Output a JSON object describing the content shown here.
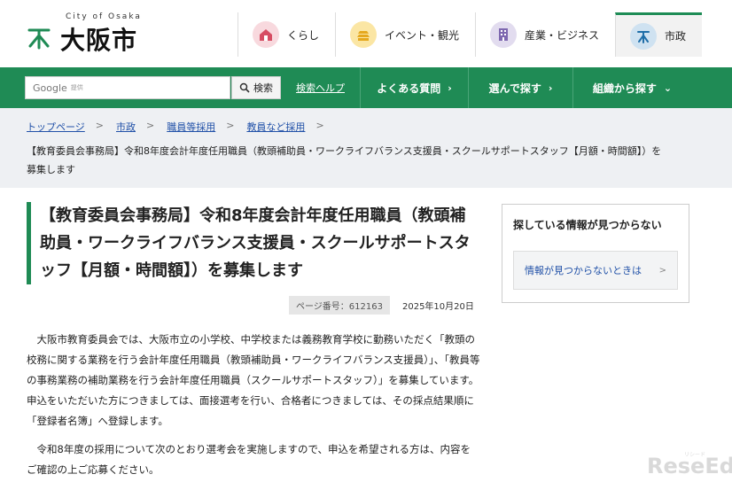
{
  "header": {
    "logo_city": "City of Osaka",
    "logo_name": "大阪市",
    "tabs": [
      {
        "label": "くらし",
        "icon": "house-icon"
      },
      {
        "label": "イベント・観光",
        "icon": "castle-icon"
      },
      {
        "label": "産業・ビジネス",
        "icon": "building-icon"
      },
      {
        "label": "市政",
        "icon": "city-emblem-icon"
      }
    ]
  },
  "search": {
    "placeholder_brand": "Google",
    "placeholder_suffix": "提供",
    "button_label": "検索",
    "help_link": "検索ヘルプ"
  },
  "gnav": {
    "faq": "よくある質問",
    "choose": "選んで探す",
    "org": "組織から探す"
  },
  "breadcrumb": {
    "items": [
      "トップページ",
      "市政",
      "職員等採用",
      "教員など採用"
    ],
    "current": "【教育委員会事務局】令和8年度会計年度任用職員（教頭補助員・ワークライフバランス支援員・スクールサポートスタッフ【月額・時間額】）を募集します"
  },
  "main": {
    "title": "【教育委員会事務局】令和8年度会計年度任用職員（教頭補助員・ワークライフバランス支援員・スクールサポートスタッフ【月額・時間額】）を募集します",
    "page_number": "ページ番号：612163",
    "date": "2025年10月20日",
    "paragraphs": [
      "大阪市教育委員会では、大阪市立の小学校、中学校または義務教育学校に勤務いただく「教頭の校務に関する業務を行う会計年度任用職員（教頭補助員・ワークライフバランス支援員）」、「教員等の事務業務の補助業務を行う会計年度任用職員（スクールサポートスタッフ）」を募集しています。申込をいただいた方につきましては、面接選考を行い、合格者につきましては、その採点結果順に「登録者名簿」へ登録します。",
      "令和8年度の採用について次のとおり選考会を実施しますので、申込を希望される方は、内容をご確認の上ご応募ください。"
    ]
  },
  "sidebar": {
    "title": "探している情報が見つからない",
    "link": "情報が見つからないときは"
  },
  "watermark": {
    "main": "ReseEd",
    "small": "リシード"
  },
  "colors": {
    "brand_green": "#1f8b55",
    "link_blue": "#2151a8",
    "breadcrumb_bg": "#eef0f3"
  }
}
